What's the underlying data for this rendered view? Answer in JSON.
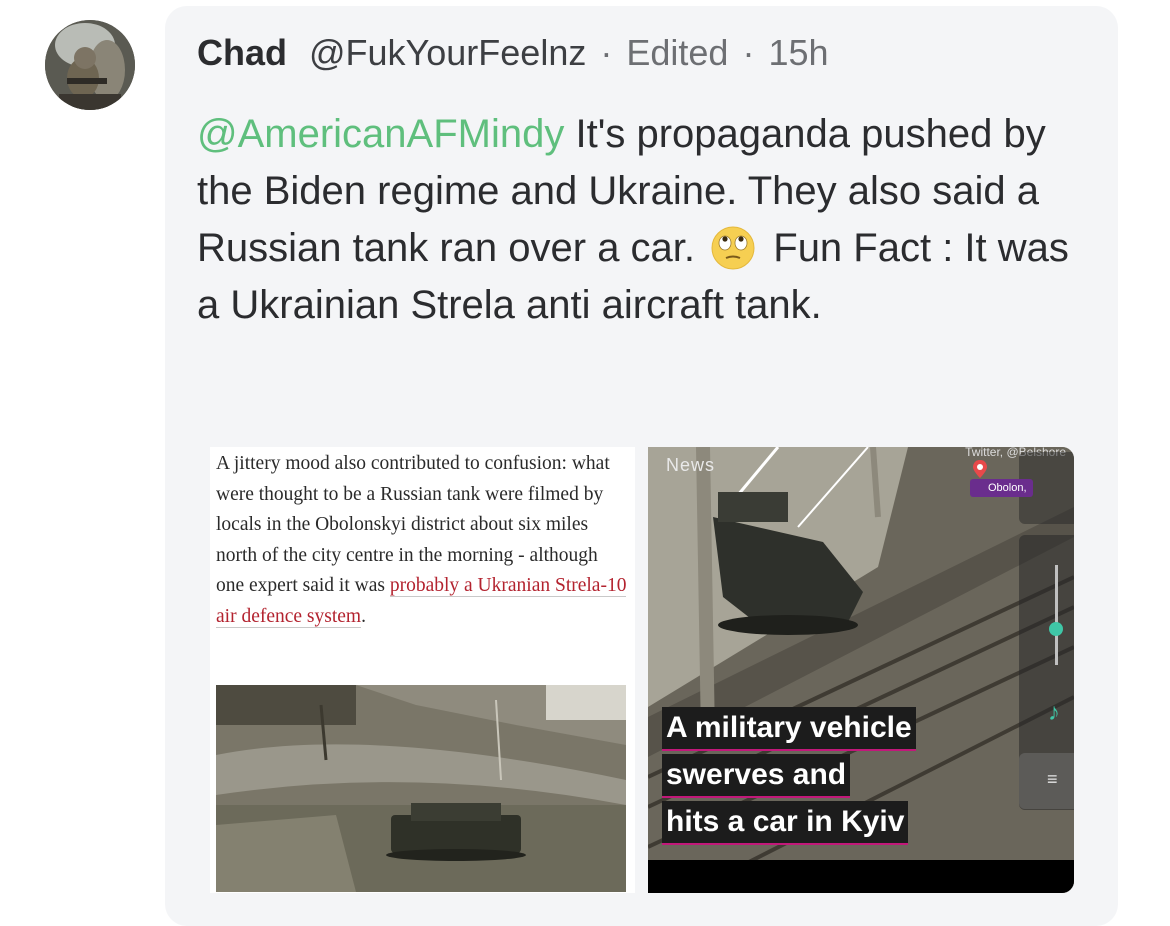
{
  "post": {
    "author_name": "Chad",
    "handle": "@FukYourFeelnz",
    "separator": "·",
    "edited_label": "Edited",
    "time_ago": "15h",
    "mention": "@AmericanAFMindy",
    "text_part1": " It's propaganda pushed by the Biden regime and Ukraine. They also said a Russian tank ran over a car. ",
    "emoji": "face-with-rolling-eyes",
    "text_part2": " Fun Fact : It was a Ukrainian Strela anti aircraft tank."
  },
  "media_left": {
    "article_text": "A jittery mood also contributed to confusion: what were thought to be a Russian tank were filmed by locals in the Obolonskyi district about six miles north of the city centre in the morning - although one expert said it was ",
    "article_link": "probably a Ukranian Strela-10 air defence system",
    "article_end": "."
  },
  "media_right": {
    "news_logo": "News",
    "credit": "Twitter, @Belshore",
    "location": "Obolon,",
    "caption_line1": "A military vehicle",
    "caption_line2": "swerves and",
    "caption_line3": "hits a car in Kyiv"
  },
  "colors": {
    "mention": "#5fbf7d",
    "bubble_bg": "#f4f5f7",
    "article_link": "#b3232f",
    "caption_underline": "#c2187a"
  }
}
